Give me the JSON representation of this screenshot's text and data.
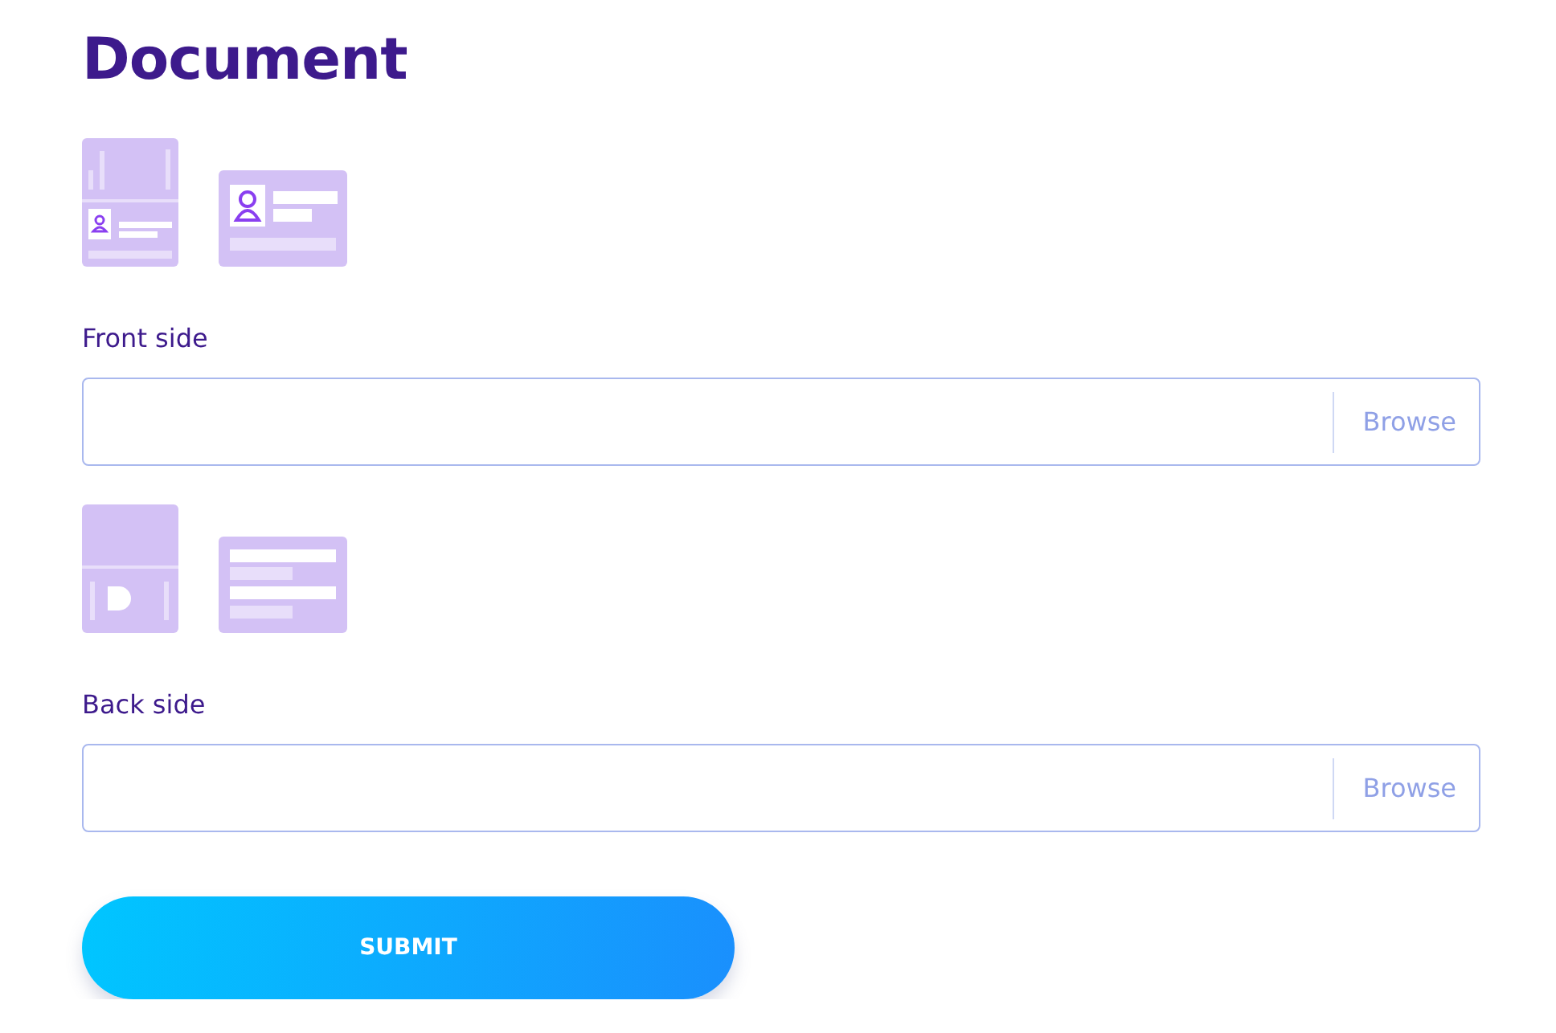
{
  "title": "Document",
  "sections": [
    {
      "kind": "front",
      "label": "Front side",
      "browse": "Browse"
    },
    {
      "kind": "back",
      "label": "Back side",
      "browse": "Browse"
    }
  ],
  "submit": "SUBMIT"
}
